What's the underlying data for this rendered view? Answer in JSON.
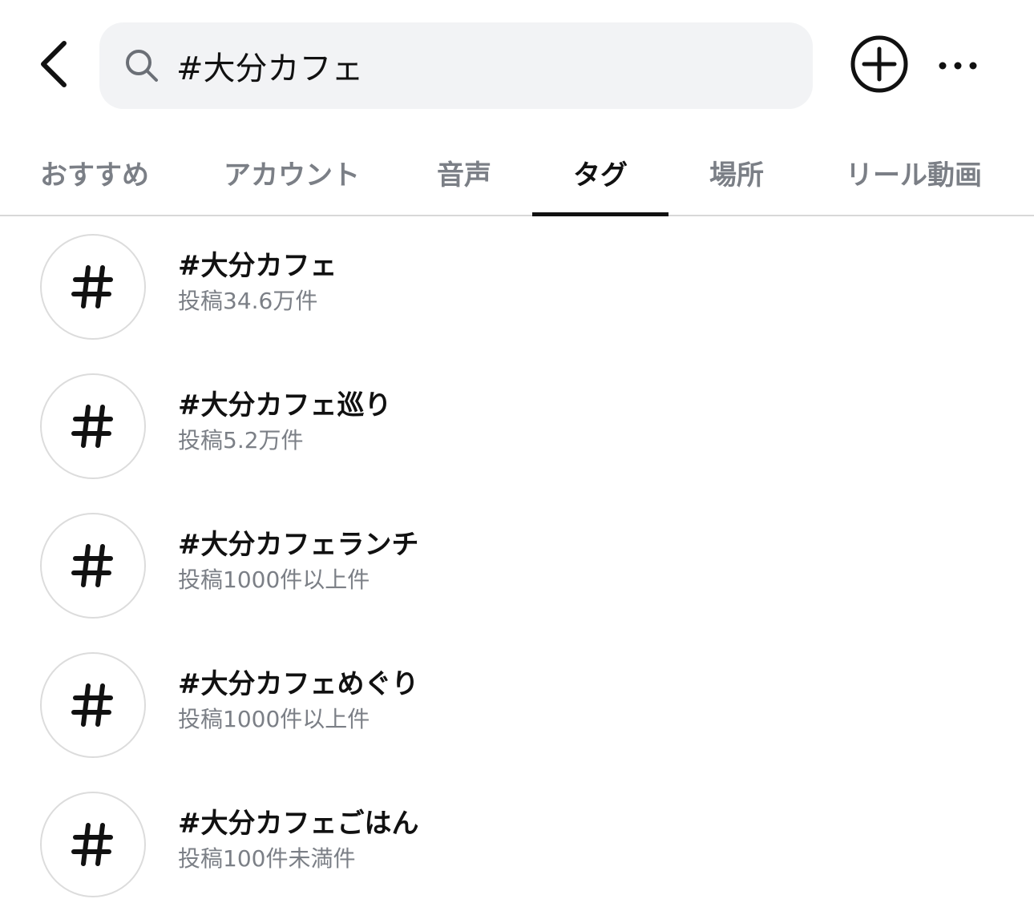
{
  "header": {
    "back_icon": "chevron-left-icon",
    "search": {
      "icon": "search-icon",
      "value": "#大分カフェ",
      "placeholder": ""
    },
    "add_icon": "plus-circle-icon",
    "more_icon": "more-horizontal-icon"
  },
  "tabs": [
    {
      "label": "おすすめ"
    },
    {
      "label": "アカウント"
    },
    {
      "label": "音声"
    },
    {
      "label": "タグ"
    },
    {
      "label": "場所"
    },
    {
      "label": "リール動画"
    }
  ],
  "active_tab": "タグ",
  "results": [
    {
      "icon": "hashtag-icon",
      "title": "#大分カフェ",
      "subtitle": "投稿34.6万件"
    },
    {
      "icon": "hashtag-icon",
      "title": "#大分カフェ巡り",
      "subtitle": "投稿5.2万件"
    },
    {
      "icon": "hashtag-icon",
      "title": "#大分カフェランチ",
      "subtitle": "投稿1000件以上件"
    },
    {
      "icon": "hashtag-icon",
      "title": "#大分カフェめぐり",
      "subtitle": "投稿1000件以上件"
    },
    {
      "icon": "hashtag-icon",
      "title": "#大分カフェごはん",
      "subtitle": "投稿100件未満件"
    }
  ],
  "colors": {
    "text_primary": "#111111",
    "text_secondary": "#7b7f86",
    "search_bg": "#f2f3f5",
    "divider": "#d8d8d8",
    "avatar_border": "#dcdcdc"
  }
}
